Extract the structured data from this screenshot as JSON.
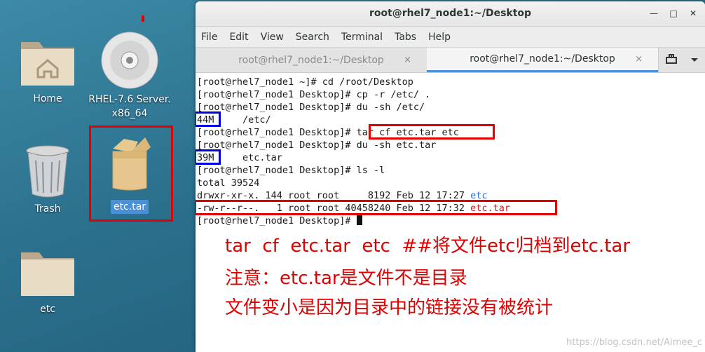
{
  "desktop": {
    "icons": [
      {
        "label": "Home"
      },
      {
        "label": "RHEL-7.6 Server.\nx86_64"
      },
      {
        "label": "Trash"
      },
      {
        "label": "etc.tar"
      },
      {
        "label": "etc"
      }
    ]
  },
  "window": {
    "title": "root@rhel7_node1:~/Desktop",
    "menu": [
      "File",
      "Edit",
      "View",
      "Search",
      "Terminal",
      "Tabs",
      "Help"
    ],
    "tabs": [
      {
        "label": "root@rhel7_node1:~/Desktop",
        "close": "×"
      },
      {
        "label": "root@rhel7_node1:~/Desktop",
        "close": "×"
      }
    ],
    "controls": {
      "minimize": "—",
      "maximize": "□",
      "close": "✕"
    }
  },
  "terminal": {
    "lines": [
      "[root@rhel7_node1 ~]# cd /root/Desktop",
      "[root@rhel7_node1 Desktop]# cp -r /etc/ .",
      "[root@rhel7_node1 Desktop]# du -sh /etc/",
      "44M     /etc/",
      "[root@rhel7_node1 Desktop]# tar cf etc.tar etc",
      "[root@rhel7_node1 Desktop]# du -sh etc.tar",
      "39M     etc.tar",
      "[root@rhel7_node1 Desktop]# ls -l",
      "total 39524"
    ],
    "ls_dir": {
      "prefix": "drwxr-xr-x. 144 root root     8192 Feb 12 17:27 ",
      "name": "etc"
    },
    "ls_tar": {
      "prefix": "-rw-r--r--.   1 root root 40458240 Feb 12 17:32 ",
      "name": "etc.tar"
    },
    "prompt": "[root@rhel7_node1 Desktop]# "
  },
  "annotations": {
    "line1": "tar  cf  etc.tar  etc  ##将文件etc归档到etc.tar",
    "line2": "注意：etc.tar是文件不是目录",
    "line3": "文件变小是因为目录中的链接没有被统计"
  },
  "watermark": "https://blog.csdn.net/Aimee_c",
  "colors": {
    "highlight_red": "#e00000",
    "highlight_blue": "#0000dd",
    "dir_blue": "#2a6fd6",
    "archive_red": "#c01c1c"
  }
}
